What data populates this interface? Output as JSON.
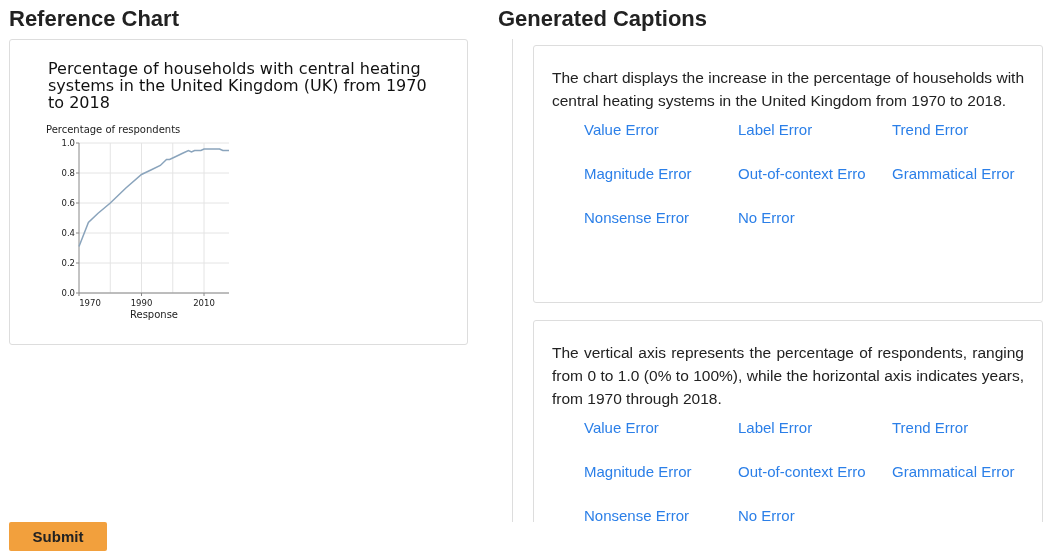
{
  "reference": {
    "heading": "Reference Chart",
    "chart_data": {
      "type": "line",
      "title": "Percentage of households with central heating systems in the United Kingdom (UK) from 1970 to 2018",
      "xlabel": "Response",
      "ylabel": "Percentage of respondents",
      "x": [
        1970,
        1973,
        1976,
        1980,
        1985,
        1990,
        1993,
        1996,
        1998,
        1999,
        2001,
        2003,
        2005,
        2006,
        2007,
        2009,
        2010,
        2012,
        2015,
        2016,
        2018
      ],
      "series": [
        {
          "color": "#8aa4bc",
          "values": [
            0.31,
            0.47,
            0.53,
            0.6,
            0.7,
            0.79,
            0.82,
            0.85,
            0.89,
            0.89,
            0.91,
            0.93,
            0.95,
            0.94,
            0.95,
            0.95,
            0.96,
            0.96,
            0.96,
            0.95,
            0.95
          ]
        }
      ],
      "grid": true,
      "xlim": [
        1970,
        2018
      ],
      "ylim": [
        0,
        1
      ],
      "xticks": [
        1970,
        1990,
        2010
      ],
      "yticks": [
        {
          "value": 0,
          "label": "0.0"
        },
        {
          "value": 0.2,
          "label": "0.2"
        },
        {
          "value": 0.4,
          "label": "0.4"
        },
        {
          "value": 0.6,
          "label": "0.6"
        },
        {
          "value": 0.8,
          "label": "0.8"
        },
        {
          "value": 1,
          "label": "1.0"
        }
      ]
    }
  },
  "captions": {
    "heading": "Generated Captions",
    "items": [
      {
        "text": "The chart displays the increase in the percentage of households with central heating systems in the United Kingdom from 1970 to 2018.",
        "options": [
          "Value Error",
          "Label Error",
          "Trend Error",
          "Magnitude Error",
          "Out-of-context Erro",
          "Grammatical Error",
          "Nonsense Error",
          "No Error"
        ]
      },
      {
        "text": "The vertical axis represents the percentage of respondents, ranging from 0 to 1.0 (0% to 100%), while the horizontal axis indicates years, from 1970 through 2018.",
        "options": [
          "Value Error",
          "Label Error",
          "Trend Error",
          "Magnitude Error",
          "Out-of-context Erro",
          "Grammatical Error",
          "Nonsense Error",
          "No Error"
        ]
      }
    ]
  },
  "submit": {
    "label": "Submit"
  }
}
